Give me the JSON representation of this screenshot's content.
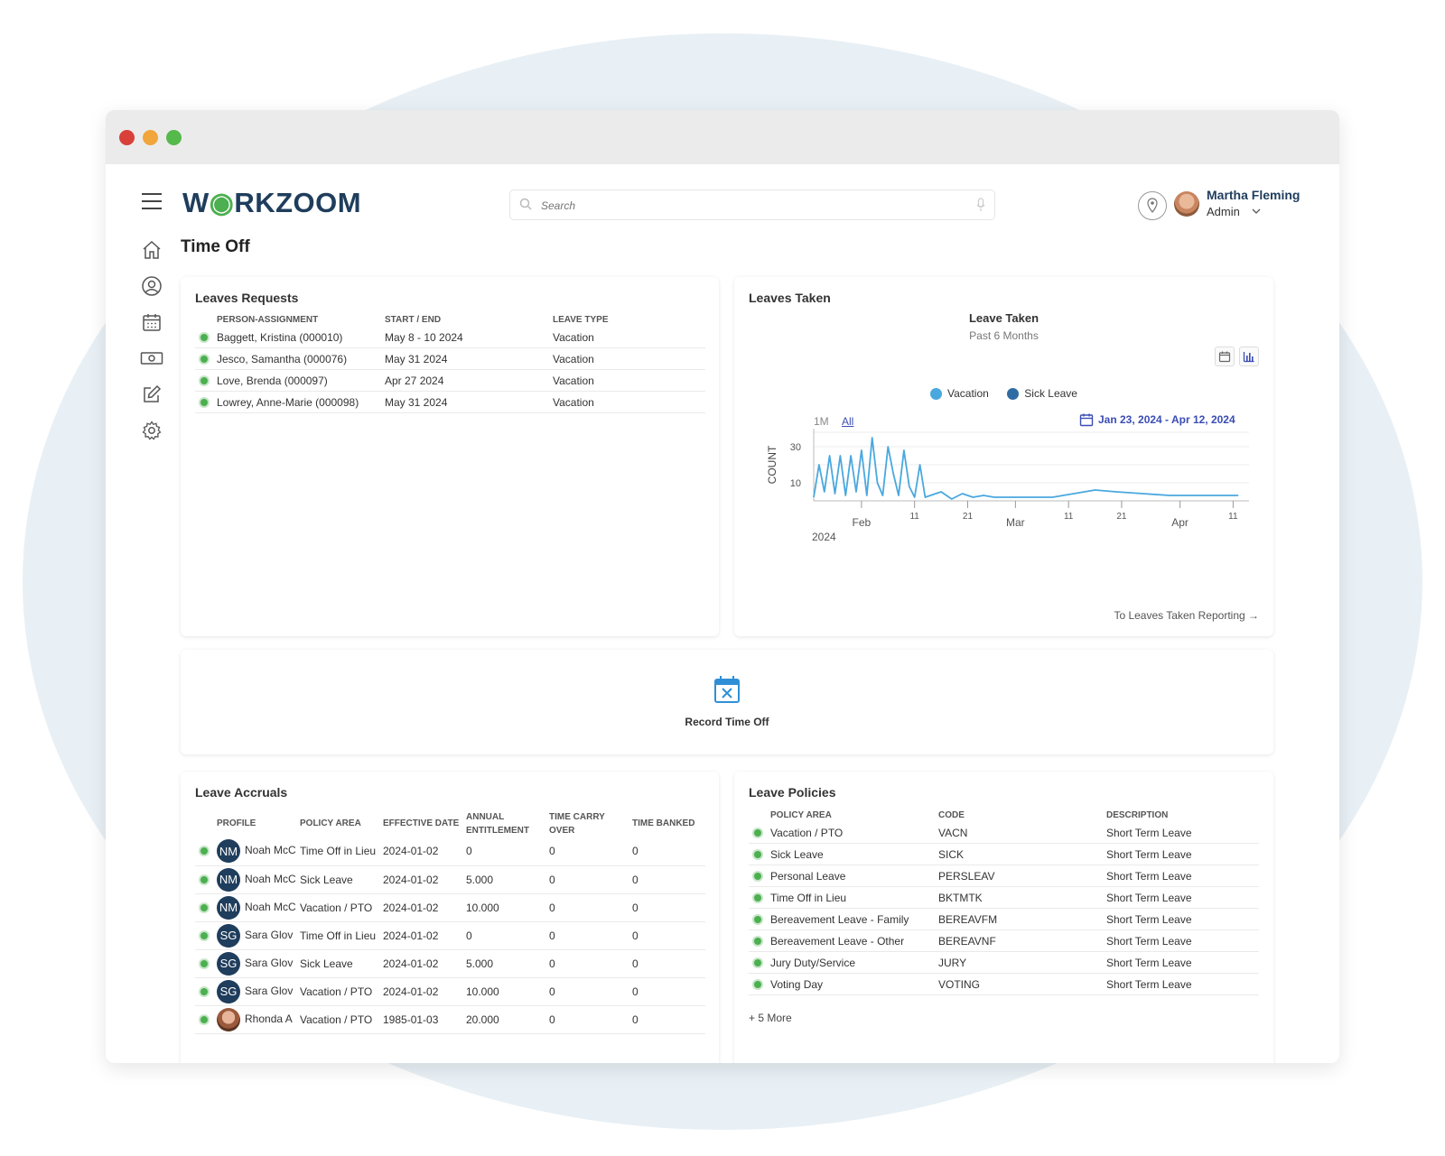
{
  "app": {
    "logo": "WORKZOOM",
    "search_placeholder": "Search",
    "user": {
      "name": "Martha Fleming",
      "role": "Admin"
    },
    "page_title": "Time Off",
    "accent_color": "#1f3d5c",
    "status_color": "#4caf50"
  },
  "sidebar": {
    "icons": [
      "home-icon",
      "profile-icon",
      "calendar-icon",
      "money-icon",
      "edit-icon",
      "settings-icon"
    ]
  },
  "leave_requests": {
    "title": "Leaves Requests",
    "columns": [
      "PERSON-ASSIGNMENT",
      "START / END",
      "LEAVE TYPE"
    ],
    "rows": [
      {
        "person": "Baggett, Kristina (000010)",
        "dates": "May 8 - 10 2024",
        "type": "Vacation"
      },
      {
        "person": "Jesco, Samantha (000076)",
        "dates": "May 31 2024",
        "type": "Vacation"
      },
      {
        "person": "Love, Brenda (000097)",
        "dates": "Apr 27 2024",
        "type": "Vacation"
      },
      {
        "person": "Lowrey, Anne-Marie (000098)",
        "dates": "May 31 2024",
        "type": "Vacation"
      }
    ]
  },
  "leaves_taken": {
    "title": "Leaves Taken",
    "chart_title": "Leave Taken",
    "chart_subtitle": "Past 6 Months",
    "legend": [
      {
        "label": "Vacation",
        "color": "#4aa8de"
      },
      {
        "label": "Sick Leave",
        "color": "#2f6ca3"
      }
    ],
    "ranges": [
      "1M",
      "All"
    ],
    "active_range": "All",
    "date_range": "Jan 23, 2024 - Apr 12, 2024",
    "reporting_link": "To Leaves Taken Reporting →"
  },
  "chart_data": {
    "type": "line",
    "ylabel": "COUNT",
    "y_ticks": [
      10,
      30
    ],
    "ylim": [
      0,
      40
    ],
    "x_ticks": [
      "Feb",
      "11",
      "21",
      "Mar",
      "11",
      "21",
      "Apr",
      "11"
    ],
    "x_year_label": "2024",
    "series": [
      {
        "name": "Vacation",
        "color": "#4aa8de",
        "x": [
          "2024-01-23",
          "2024-01-24",
          "2024-01-25",
          "2024-01-26",
          "2024-01-27",
          "2024-01-28",
          "2024-01-29",
          "2024-01-30",
          "2024-01-31",
          "2024-02-01",
          "2024-02-02",
          "2024-02-03",
          "2024-02-04",
          "2024-02-05",
          "2024-02-06",
          "2024-02-07",
          "2024-02-08",
          "2024-02-09",
          "2024-02-10",
          "2024-02-11",
          "2024-02-12",
          "2024-02-13",
          "2024-02-14",
          "2024-02-16",
          "2024-02-18",
          "2024-02-20",
          "2024-02-22",
          "2024-02-24",
          "2024-02-26",
          "2024-02-28",
          "2024-03-01",
          "2024-03-04",
          "2024-03-08",
          "2024-03-12",
          "2024-03-16",
          "2024-03-20",
          "2024-03-25",
          "2024-03-30",
          "2024-04-05",
          "2024-04-12"
        ],
        "values": [
          2,
          20,
          5,
          25,
          4,
          25,
          3,
          25,
          5,
          28,
          3,
          35,
          10,
          3,
          30,
          15,
          3,
          28,
          8,
          2,
          20,
          2,
          3,
          5,
          1,
          4,
          2,
          3,
          2,
          2,
          2,
          2,
          2,
          4,
          6,
          5,
          4,
          3,
          3,
          3
        ]
      }
    ]
  },
  "record": {
    "label": "Record Time Off"
  },
  "leave_accruals": {
    "title": "Leave Accruals",
    "columns": [
      "PROFILE",
      "POLICY AREA",
      "EFFECTIVE DATE",
      "ANNUAL ENTITLEMENT",
      "TIME CARRY OVER",
      "TIME BANKED"
    ],
    "rows": [
      {
        "initials": "NM",
        "profile": "Noah McC",
        "policy": "Time Off in Lieu",
        "date": "2024-01-02",
        "annual": "0",
        "carry": "0",
        "banked": "0"
      },
      {
        "initials": "NM",
        "profile": "Noah McC",
        "policy": "Sick Leave",
        "date": "2024-01-02",
        "annual": "5.000",
        "carry": "0",
        "banked": "0"
      },
      {
        "initials": "NM",
        "profile": "Noah McC",
        "policy": "Vacation / PTO",
        "date": "2024-01-02",
        "annual": "10.000",
        "carry": "0",
        "banked": "0"
      },
      {
        "initials": "SG",
        "profile": "Sara Glov",
        "policy": "Time Off in Lieu",
        "date": "2024-01-02",
        "annual": "0",
        "carry": "0",
        "banked": "0"
      },
      {
        "initials": "SG",
        "profile": "Sara Glov",
        "policy": "Sick Leave",
        "date": "2024-01-02",
        "annual": "5.000",
        "carry": "0",
        "banked": "0"
      },
      {
        "initials": "SG",
        "profile": "Sara Glov",
        "policy": "Vacation / PTO",
        "date": "2024-01-02",
        "annual": "10.000",
        "carry": "0",
        "banked": "0"
      },
      {
        "initials": "",
        "profile": "Rhonda A",
        "policy": "Vacation / PTO",
        "date": "1985-01-03",
        "annual": "20.000",
        "carry": "0",
        "banked": "0"
      }
    ]
  },
  "leave_policies": {
    "title": "Leave Policies",
    "columns": [
      "POLICY AREA",
      "CODE",
      "DESCRIPTION"
    ],
    "rows": [
      {
        "area": "Vacation / PTO",
        "code": "VACN",
        "desc": "Short Term Leave"
      },
      {
        "area": "Sick Leave",
        "code": "SICK",
        "desc": "Short Term Leave"
      },
      {
        "area": "Personal Leave",
        "code": "PERSLEAV",
        "desc": "Short Term Leave"
      },
      {
        "area": "Time Off in Lieu",
        "code": "BKTMTK",
        "desc": "Short Term Leave"
      },
      {
        "area": "Bereavement Leave - Family",
        "code": "BEREAVFM",
        "desc": "Short Term Leave"
      },
      {
        "area": "Bereavement Leave - Other",
        "code": "BEREAVNF",
        "desc": "Short Term Leave"
      },
      {
        "area": "Jury Duty/Service",
        "code": "JURY",
        "desc": "Short Term Leave"
      },
      {
        "area": "Voting Day",
        "code": "VOTING",
        "desc": "Short Term Leave"
      }
    ],
    "more": "+ 5 More"
  }
}
